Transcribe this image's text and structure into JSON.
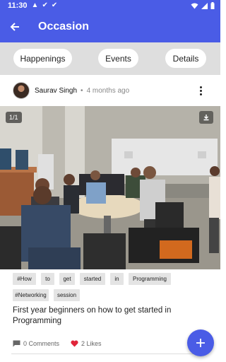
{
  "status_bar": {
    "time": "11:30"
  },
  "app_bar": {
    "title": "Occasion"
  },
  "tabs": [
    {
      "label": "Happenings"
    },
    {
      "label": "Events"
    },
    {
      "label": "Details"
    }
  ],
  "post": {
    "author": "Saurav Singh",
    "separator": "•",
    "time_ago": "4 months ago",
    "image_counter": "1/1",
    "tags": [
      "#How",
      "to",
      "get",
      "started",
      "in",
      "Programming",
      "#Networking",
      "session"
    ],
    "caption": "First year beginners on how to get started in Programming",
    "comments": "0 Comments",
    "likes": "2 Likes"
  },
  "colors": {
    "primary": "#4a5ce6",
    "like": "#e0243a",
    "tab_strip": "#dedede"
  },
  "icons": [
    "back-arrow-icon",
    "more-vert-icon",
    "download-icon",
    "comment-icon",
    "heart-icon",
    "add-icon",
    "wifi-icon",
    "battery-icon"
  ]
}
